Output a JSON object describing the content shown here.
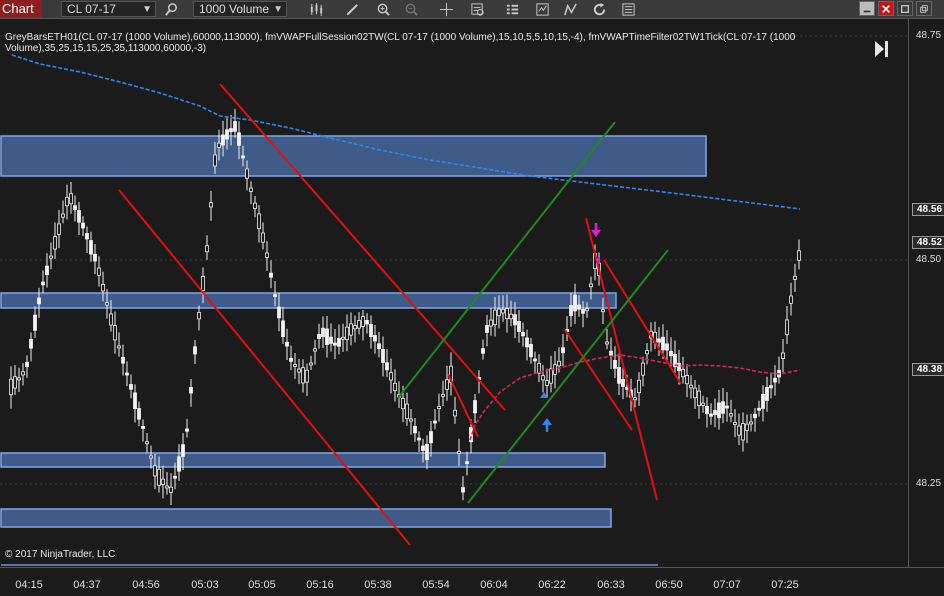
{
  "toolbar": {
    "tab_label": "Chart",
    "instrument": "CL 07-17",
    "interval": "1000 Volume",
    "icons": [
      "search-icon",
      "bars-icon",
      "pencil-icon",
      "zoom-in-icon",
      "zoom-out-icon",
      "crosshair-icon",
      "data-box-icon",
      "properties-icon",
      "strategies-icon",
      "drawing-tools-icon",
      "refresh-icon",
      "chart-trader-icon"
    ]
  },
  "indicator_text": "GreyBarsETH01(CL 07-17 (1000 Volume),60000,113000), fmVWAPFullSession02TW(CL 07-17 (1000 Volume),15,10,5,5,10,15,-4), fmVWAPTimeFilter02TW1Tick(CL 07-17 (1000 Volume),35,25,15,15,25,35,113000,60000,-3)",
  "copyright": "© 2017 NinjaTrader, LLC",
  "y_axis": {
    "ticks": [
      "48.75",
      "48.50",
      "48.25"
    ],
    "price_tags": [
      "48.56",
      "48.52",
      "48.38"
    ]
  },
  "x_axis": {
    "ticks": [
      "04:15",
      "04:37",
      "04:56",
      "05:03",
      "05:05",
      "05:16",
      "05:38",
      "05:54",
      "06:04",
      "06:22",
      "06:33",
      "06:50",
      "07:07",
      "07:25"
    ]
  },
  "colors": {
    "background": "#1b1b1b",
    "candle_up": "#f2f2f2",
    "zone_fill": "#4e76b6",
    "red_channel": "#e01010",
    "green_channel": "#1e8a1e",
    "vwap_blue": "#2f86f0",
    "vwap_pink": "#e0205a",
    "arrow_magenta": "#e020d0"
  }
}
